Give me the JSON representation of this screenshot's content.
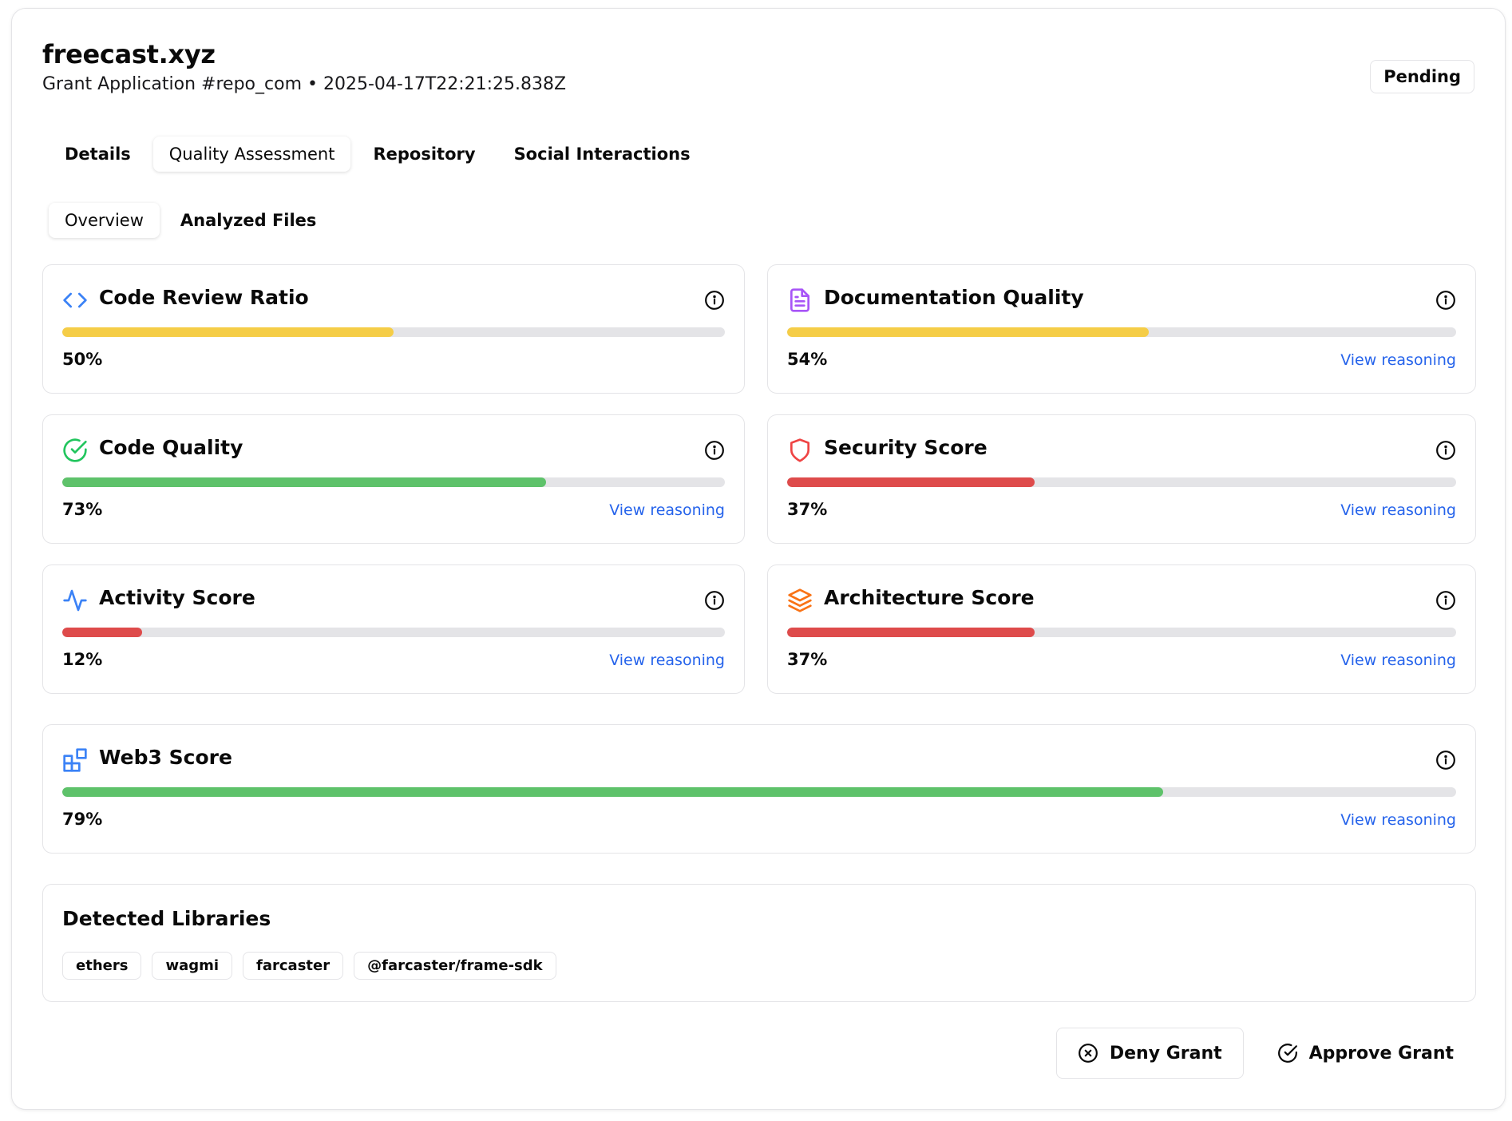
{
  "header": {
    "app_title": "freecast.xyz",
    "subtitle": "Grant Application #repo_com • 2025-04-17T22:21:25.838Z",
    "status": "Pending"
  },
  "tabs": [
    {
      "label": "Details",
      "active": false
    },
    {
      "label": "Quality Assessment",
      "active": true
    },
    {
      "label": "Repository",
      "active": false
    },
    {
      "label": "Social Interactions",
      "active": false
    }
  ],
  "subtabs": [
    {
      "label": "Overview",
      "active": true
    },
    {
      "label": "Analyzed Files",
      "active": false
    }
  ],
  "scores": {
    "code_review": {
      "title": "Code Review Ratio",
      "value": "50%",
      "level": 0.5,
      "color": "#f5cd47",
      "icon": "code-icon",
      "reason": ""
    },
    "documentation": {
      "title": "Documentation Quality",
      "value": "54%",
      "level": 0.54,
      "color": "#f5cd47",
      "icon": "document-icon",
      "reason": "View reasoning"
    },
    "code_quality": {
      "title": "Code Quality",
      "value": "73%",
      "level": 0.73,
      "color": "#5ec26a",
      "icon": "check-circle-icon",
      "reason": "View reasoning"
    },
    "security": {
      "title": "Security Score",
      "value": "37%",
      "level": 0.37,
      "color": "#de4b4b",
      "icon": "shield-icon",
      "reason": "View reasoning"
    },
    "activity": {
      "title": "Activity Score",
      "value": "12%",
      "level": 0.12,
      "color": "#de4b4b",
      "icon": "activity-icon",
      "reason": "View reasoning"
    },
    "architecture": {
      "title": "Architecture Score",
      "value": "37%",
      "level": 0.37,
      "color": "#de4b4b",
      "icon": "layers-icon",
      "reason": "View reasoning"
    },
    "web3": {
      "title": "Web3 Score",
      "value": "79%",
      "level": 0.79,
      "color": "#5ec26a",
      "icon": "blocks-icon",
      "reason": "View reasoning"
    }
  },
  "libraries": {
    "title": "Detected Libraries",
    "items": [
      "ethers",
      "wagmi",
      "farcaster",
      "@farcaster/frame-sdk"
    ]
  },
  "actions": {
    "deny_label": "Deny Grant",
    "approve_label": "Approve Grant"
  },
  "colors": {
    "link": "#2563eb",
    "track": "#e4e4e7"
  }
}
